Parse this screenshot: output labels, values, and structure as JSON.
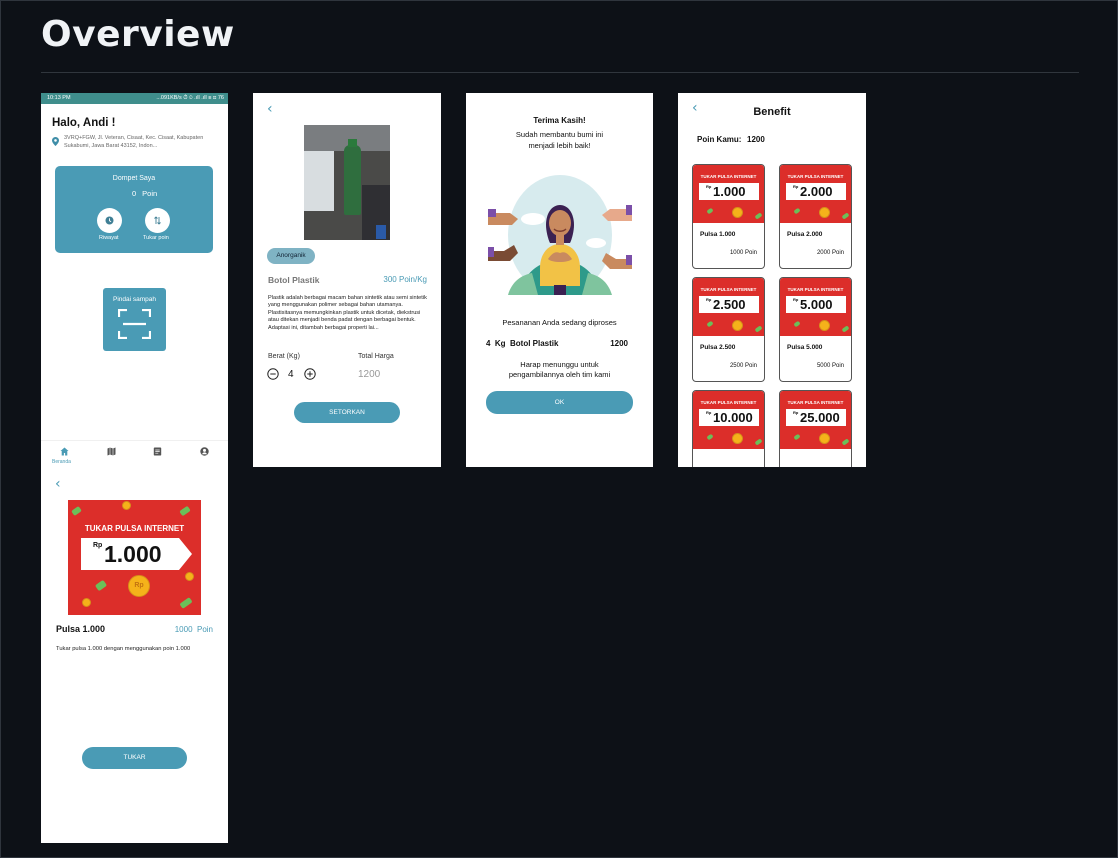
{
  "page": {
    "title": "Overview"
  },
  "home": {
    "status_time": "10:13 PM",
    "status_right": "...091KB/s ⏱ ⊙ .ıll .ıll ≋ ⊡ 76",
    "greeting": "Halo, Andi !",
    "address": "3VRQ+FGW, Jl. Veteran, Cisaat, Kec. Cisaat, Kabupaten Sukabumi, Jawa Barat 43152, Indon...",
    "wallet_title": "Dompet Saya",
    "wallet_points": "0",
    "wallet_unit": "Poin",
    "history_label": "Riwayat",
    "exchange_label": "Tukar poin",
    "scan_label": "Pindai sampah",
    "nav_home_label": "Beranda"
  },
  "detail": {
    "category": "Anorganik",
    "product_name": "Botol Plastik",
    "product_points": "300 Poin/Kg",
    "description": "Plastik adalah berbagai macam bahan sintetik atau semi sintetik yang menggunakan polimer sebagai bahan utamanya. Plastisitasnya memungkinkan plastik untuk dicetak, diekstrusi atau ditekan menjadi benda padat dengan berbagai bentuk. Adaptasi ini, ditambah berbagai properti lai...",
    "weight_label": "Berat (Kg)",
    "weight_value": "4",
    "total_label": "Total Harga",
    "total_value": "1200",
    "submit_label": "SETORKAN"
  },
  "thanks": {
    "title": "Terima Kasih!",
    "subtitle": "Sudah membantu bumi ini menjadi lebih baik!",
    "processing": "Pesananan Anda sedang diproses",
    "order_qty": "4  Kg  Botol Plastik",
    "order_total": "1200",
    "waiting": "Harap menunggu untuk pengambilannya oleh tim kami",
    "ok_label": "OK"
  },
  "benefit": {
    "title": "Benefit",
    "points_label": "Poin Kamu:",
    "points_value": "1200",
    "card_header": "TUKAR PULSA INTERNET",
    "currency": "Rp",
    "cards": [
      {
        "amount": "1.000",
        "name": "Pulsa 1.000",
        "points": "1000 Poin"
      },
      {
        "amount": "2.000",
        "name": "Pulsa 2.000",
        "points": "2000 Poin"
      },
      {
        "amount": "2.500",
        "name": "Pulsa 2.500",
        "points": "2500 Poin"
      },
      {
        "amount": "5.000",
        "name": "Pulsa 5.000",
        "points": "5000 Poin"
      },
      {
        "amount": "10.000",
        "name": "",
        "points": ""
      },
      {
        "amount": "25.000",
        "name": "",
        "points": ""
      }
    ]
  },
  "redeem": {
    "card_header": "TUKAR PULSA INTERNET",
    "currency": "Rp",
    "amount": "1.000",
    "name": "Pulsa 1.000",
    "points": "1000  Poin",
    "description": "Tukar pulsa 1.000 dengan menggunakan poin 1.000",
    "button_label": "TUKAR"
  },
  "colors": {
    "accent": "#4a9bb5",
    "voucher_red": "#dc2e2a",
    "background": "#0d1117"
  }
}
